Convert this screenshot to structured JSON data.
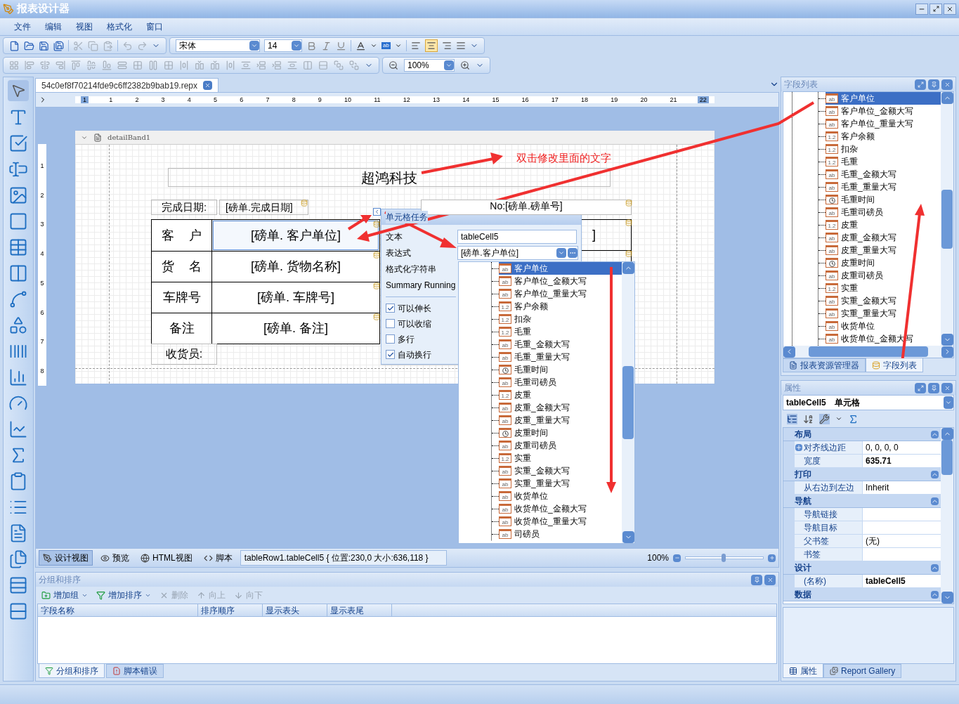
{
  "window": {
    "title": "报表设计器"
  },
  "menu": [
    "文件",
    "编辑",
    "视图",
    "格式化",
    "窗口"
  ],
  "toolbar": {
    "font": "宋体",
    "size": "14",
    "highlight_label": "ab",
    "zoom": "100%"
  },
  "document_tab": {
    "title": "54c0ef8f70214fde9c6ff2382b9bab19.repx"
  },
  "ruler": {
    "marks": [
      "1",
      "1",
      "2",
      "3",
      "4",
      "5",
      "6",
      "7",
      "8",
      "9",
      "10",
      "11",
      "12",
      "13",
      "14",
      "15",
      "16",
      "17",
      "18",
      "19",
      "20",
      "21",
      "22"
    ],
    "vertical_marks": [
      "1",
      "2",
      "3",
      "4",
      "5",
      "6",
      "7",
      "8"
    ]
  },
  "band": {
    "name": "detailBand1"
  },
  "report": {
    "title": "超鸿科技",
    "date_label": "完成日期:",
    "date_value": "[磅单.完成日期]",
    "number_value": "No:[磅单.磅单号]",
    "right_cell": "]",
    "receiver_label": "收货员:",
    "rows": [
      {
        "label": "客 户",
        "value": "[磅单. 客户单位]",
        "selected": true
      },
      {
        "label": "货 名",
        "value": "[磅单. 货物名称]",
        "selected": false
      },
      {
        "label": "车牌号",
        "value": "[磅单. 车牌号]",
        "selected": false
      },
      {
        "label": "备注",
        "value": "[磅单. 备注]",
        "selected": false
      }
    ]
  },
  "annotation": "双击修改里面的文字",
  "smart_tag": {
    "title": "单元格任务",
    "fields": [
      {
        "label": "文本",
        "kind": "text",
        "value": "tableCell5"
      },
      {
        "label": "表达式",
        "kind": "combo",
        "value": "[磅单.客户单位]"
      },
      {
        "label": "格式化字符串",
        "kind": "none"
      },
      {
        "label": "Summary Running",
        "kind": "none"
      }
    ],
    "options": [
      {
        "label": "可以伸长",
        "checked": true
      },
      {
        "label": "可以收缩",
        "checked": false
      },
      {
        "label": "多行",
        "checked": false
      },
      {
        "label": "自动换行",
        "checked": true
      }
    ]
  },
  "expression_dropdown": {
    "items": [
      {
        "name": "客户单位",
        "kind": "text",
        "badge": "ab",
        "selected": true
      },
      {
        "name": "客户单位_金额大写",
        "kind": "text",
        "badge": "ab",
        "selected": false
      },
      {
        "name": "客户单位_重量大写",
        "kind": "text",
        "badge": "ab",
        "selected": false
      },
      {
        "name": "客户余额",
        "kind": "number",
        "badge": "1.2",
        "selected": false
      },
      {
        "name": "扣杂",
        "kind": "number",
        "badge": "1.2",
        "selected": false
      },
      {
        "name": "毛重",
        "kind": "number",
        "badge": "1.2",
        "selected": false
      },
      {
        "name": "毛重_金额大写",
        "kind": "text",
        "badge": "ab",
        "selected": false
      },
      {
        "name": "毛重_重量大写",
        "kind": "text",
        "badge": "ab",
        "selected": false
      },
      {
        "name": "毛重时间",
        "kind": "time",
        "selected": false
      },
      {
        "name": "毛重司磅员",
        "kind": "text",
        "badge": "ab",
        "selected": false
      },
      {
        "name": "皮重",
        "kind": "number",
        "badge": "1.2",
        "selected": false
      },
      {
        "name": "皮重_金额大写",
        "kind": "text",
        "badge": "ab",
        "selected": false
      },
      {
        "name": "皮重_重量大写",
        "kind": "text",
        "badge": "ab",
        "selected": false
      },
      {
        "name": "皮重时间",
        "kind": "time",
        "selected": false
      },
      {
        "name": "皮重司磅员",
        "kind": "text",
        "badge": "ab",
        "selected": false
      },
      {
        "name": "实重",
        "kind": "number",
        "badge": "1.2",
        "selected": false
      },
      {
        "name": "实重_金额大写",
        "kind": "text",
        "badge": "ab",
        "selected": false
      },
      {
        "name": "实重_重量大写",
        "kind": "text",
        "badge": "ab",
        "selected": false
      },
      {
        "name": "收货单位",
        "kind": "text",
        "badge": "ab",
        "selected": false
      },
      {
        "name": "收货单位_金额大写",
        "kind": "text",
        "badge": "ab",
        "selected": false
      },
      {
        "name": "收货单位_重量大写",
        "kind": "text",
        "badge": "ab",
        "selected": false
      },
      {
        "name": "司磅员",
        "kind": "text",
        "badge": "ab",
        "selected": false
      }
    ]
  },
  "field_list": {
    "title": "字段列表",
    "items": [
      {
        "name": "客户单位",
        "kind": "text",
        "badge": "ab",
        "selected": true
      },
      {
        "name": "客户单位_金额大写",
        "kind": "text",
        "badge": "ab",
        "selected": false
      },
      {
        "name": "客户单位_重量大写",
        "kind": "text",
        "badge": "ab",
        "selected": false
      },
      {
        "name": "客户余额",
        "kind": "number",
        "badge": "1.2",
        "selected": false
      },
      {
        "name": "扣杂",
        "kind": "number",
        "badge": "1.2",
        "selected": false
      },
      {
        "name": "毛重",
        "kind": "number",
        "badge": "1.2",
        "selected": false
      },
      {
        "name": "毛重_金额大写",
        "kind": "text",
        "badge": "ab",
        "selected": false
      },
      {
        "name": "毛重_重量大写",
        "kind": "text",
        "badge": "ab",
        "selected": false
      },
      {
        "name": "毛重时间",
        "kind": "time",
        "selected": false
      },
      {
        "name": "毛重司磅员",
        "kind": "text",
        "badge": "ab",
        "selected": false
      },
      {
        "name": "皮重",
        "kind": "number",
        "badge": "1.2",
        "selected": false
      },
      {
        "name": "皮重_金额大写",
        "kind": "text",
        "badge": "ab",
        "selected": false
      },
      {
        "name": "皮重_重量大写",
        "kind": "text",
        "badge": "ab",
        "selected": false
      },
      {
        "name": "皮重时间",
        "kind": "time",
        "selected": false
      },
      {
        "name": "皮重司磅员",
        "kind": "text",
        "badge": "ab",
        "selected": false
      },
      {
        "name": "实重",
        "kind": "number",
        "badge": "1.2",
        "selected": false
      },
      {
        "name": "实重_金额大写",
        "kind": "text",
        "badge": "ab",
        "selected": false
      },
      {
        "name": "实重_重量大写",
        "kind": "text",
        "badge": "ab",
        "selected": false
      },
      {
        "name": "收货单位",
        "kind": "text",
        "badge": "ab",
        "selected": false
      },
      {
        "name": "收货单位_金额大写",
        "kind": "text",
        "badge": "ab",
        "selected": false
      }
    ],
    "tabs": [
      {
        "label": "报表资源管理器",
        "selected": false
      },
      {
        "label": "字段列表",
        "selected": true
      }
    ]
  },
  "properties": {
    "title": "属性",
    "object": "tableCell5",
    "object_type": "单元格",
    "categories": [
      {
        "name": "布局",
        "rows": [
          {
            "name": "对齐线边距",
            "value": "0, 0, 0, 0",
            "expandable": true,
            "bold": false
          },
          {
            "name": "宽度",
            "value": "635.71",
            "expandable": false,
            "bold": true
          }
        ]
      },
      {
        "name": "打印",
        "rows": [
          {
            "name": "从右边到左边",
            "value": "Inherit",
            "expandable": false,
            "bold": false
          }
        ]
      },
      {
        "name": "导航",
        "rows": [
          {
            "name": "导航链接",
            "value": "",
            "expandable": false
          },
          {
            "name": "导航目标",
            "value": "",
            "expandable": false
          },
          {
            "name": "父书签",
            "value": "(无)",
            "expandable": false,
            "bold": false
          },
          {
            "name": "书签",
            "value": "",
            "expandable": false
          }
        ]
      },
      {
        "name": "设计",
        "rows": [
          {
            "name": "(名称)",
            "value": "tableCell5",
            "expandable": false,
            "bold": true
          }
        ]
      },
      {
        "name": "数据"
      }
    ],
    "tabs": [
      {
        "label": "属性",
        "selected": true
      },
      {
        "label": "Report Gallery",
        "selected": false
      }
    ]
  },
  "view_tabs": [
    {
      "label": "设计视图",
      "selected": true
    },
    {
      "label": "预览",
      "selected": false
    },
    {
      "label": "HTML视图",
      "selected": false
    },
    {
      "label": "脚本",
      "selected": false
    }
  ],
  "status_text": "tableRow1.tableCell5 { 位置:230,0 大小:636,118 }",
  "zoom": {
    "reading": "100%",
    "level": 0.49
  },
  "group_panel": {
    "title": "分组和排序",
    "actions": [
      {
        "label": "增加组",
        "disabled": false,
        "menu": true
      },
      {
        "label": "增加排序",
        "disabled": false,
        "menu": true
      },
      {
        "label": "删除",
        "disabled": true,
        "menu": false
      },
      {
        "label": "向上",
        "disabled": true,
        "menu": false
      },
      {
        "label": "向下",
        "disabled": true,
        "menu": false
      }
    ],
    "columns": [
      "字段名称",
      "排序顺序",
      "显示表头",
      "显示表尾"
    ],
    "tabs": [
      {
        "label": "分组和排序",
        "selected": true
      },
      {
        "label": "脚本错误",
        "selected": false
      }
    ]
  }
}
